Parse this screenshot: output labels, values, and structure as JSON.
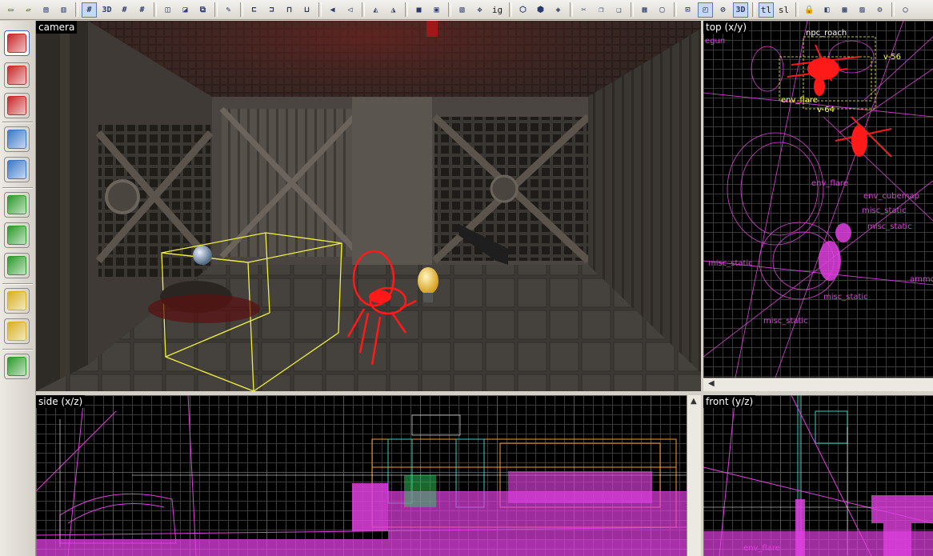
{
  "toolbar": {
    "items": [
      {
        "name": "new-file-icon",
        "glyph": "▭"
      },
      {
        "name": "open-file-icon",
        "glyph": "▱"
      },
      {
        "name": "save-icon",
        "glyph": "▤"
      },
      {
        "name": "save-as-icon",
        "glyph": "▥"
      },
      {
        "sep": true
      },
      {
        "name": "grid-icon",
        "glyph": "#",
        "pressed": true
      },
      {
        "name": "3d-grid-icon",
        "glyph": "3D"
      },
      {
        "name": "grid-smaller-icon",
        "glyph": "#"
      },
      {
        "name": "grid-larger-icon",
        "glyph": "#"
      },
      {
        "sep": true
      },
      {
        "name": "group-icon",
        "glyph": "◫"
      },
      {
        "name": "ungroup-icon",
        "glyph": "◪"
      },
      {
        "name": "ignore-groups-icon",
        "glyph": "⧉"
      },
      {
        "sep": true
      },
      {
        "name": "texture-lock-icon",
        "glyph": "✎"
      },
      {
        "sep": true
      },
      {
        "name": "align-left-icon",
        "glyph": "⊏"
      },
      {
        "name": "align-right-icon",
        "glyph": "⊐"
      },
      {
        "name": "align-top-icon",
        "glyph": "⊓"
      },
      {
        "name": "align-bottom-icon",
        "glyph": "⊔"
      },
      {
        "sep": true
      },
      {
        "name": "flip-horizontal-icon",
        "glyph": "◀"
      },
      {
        "name": "flip-vertical-icon",
        "glyph": "◁"
      },
      {
        "sep": true
      },
      {
        "name": "rotate-icon",
        "glyph": "◭"
      },
      {
        "name": "rotate-ccw-icon",
        "glyph": "◮"
      },
      {
        "sep": true
      },
      {
        "name": "carve-icon",
        "glyph": "■"
      },
      {
        "name": "hollow-icon",
        "glyph": "▣"
      },
      {
        "sep": true
      },
      {
        "name": "clip-icon",
        "glyph": "▧"
      },
      {
        "name": "vertex-icon",
        "glyph": "✥"
      },
      {
        "name": "ig-toggle",
        "text": "ig"
      },
      {
        "sep": true
      },
      {
        "name": "cordon-icon",
        "glyph": "⬡"
      },
      {
        "name": "cordon-edit-icon",
        "glyph": "⬢"
      },
      {
        "name": "hide-icon",
        "glyph": "◈"
      },
      {
        "sep": true
      },
      {
        "name": "cut-icon",
        "glyph": "✂"
      },
      {
        "name": "copy-icon",
        "glyph": "❐"
      },
      {
        "name": "paste-icon",
        "glyph": "❑"
      },
      {
        "sep": true
      },
      {
        "name": "select-all-icon",
        "glyph": "▦"
      },
      {
        "name": "select-box-icon",
        "glyph": "▢"
      },
      {
        "sep": true
      },
      {
        "name": "zoom-fit-icon",
        "glyph": "⊡"
      },
      {
        "name": "select-mode-icon",
        "glyph": "◰",
        "pressed": true
      },
      {
        "name": "no-draw-icon",
        "glyph": "⊘"
      },
      {
        "name": "3d-view-icon",
        "glyph": "3D",
        "pressed": true
      },
      {
        "sep": true
      },
      {
        "name": "texture-lock-toggle",
        "text": "tl",
        "pressed": true
      },
      {
        "name": "sl-toggle",
        "text": "sl"
      },
      {
        "sep": true
      },
      {
        "name": "lock-icon",
        "glyph": "🔒"
      },
      {
        "name": "color-icon",
        "glyph": "◧"
      },
      {
        "name": "entity-report-icon",
        "glyph": "▩"
      },
      {
        "name": "check-problems-icon",
        "glyph": "▨"
      },
      {
        "name": "tools-icon",
        "glyph": "⚙"
      },
      {
        "sep": true
      },
      {
        "name": "help-icon",
        "glyph": "◯"
      }
    ]
  },
  "left_tools": [
    {
      "name": "selection-tool-icon",
      "color": "#c8282a",
      "active": true
    },
    {
      "name": "magnify-tool-icon",
      "color": "#c8282a"
    },
    {
      "name": "camera-tool-icon",
      "color": "#c8282a"
    },
    {
      "name": "entity-tool-icon",
      "color": "#3a78c8"
    },
    {
      "name": "block-tool-icon",
      "color": "#3a78c8"
    },
    {
      "name": "texture-tool-icon",
      "color": "#2a9a2a"
    },
    {
      "name": "apply-texture-icon",
      "color": "#2a9a2a"
    },
    {
      "name": "decal-tool-icon",
      "color": "#2a9a2a"
    },
    {
      "name": "overlay-tool-icon",
      "color": "#d8b020"
    },
    {
      "name": "clipping-tool-icon",
      "color": "#d8b020"
    },
    {
      "name": "vertex-tool-icon",
      "color": "#2a9a2a"
    }
  ],
  "viewports": {
    "camera": {
      "label": "camera"
    },
    "top": {
      "label": "top (x/y)"
    },
    "side": {
      "label": "side (x/z)"
    },
    "front": {
      "label": "front (y/z)"
    }
  },
  "top_entities": [
    {
      "text": "npc_roach",
      "color": "#ffffff"
    },
    {
      "text": "egun",
      "color": "#e040e0"
    },
    {
      "text": "v-56",
      "color": "#ffff40"
    },
    {
      "text": "env_flare",
      "color": "#ffff40"
    },
    {
      "text": "v-64",
      "color": "#ffff40"
    },
    {
      "text": "env_flare",
      "color": "#e040e0"
    },
    {
      "text": "env_cubemap",
      "color": "#e040e0"
    },
    {
      "text": "misc_static",
      "color": "#e040e0"
    },
    {
      "text": "misc_static",
      "color": "#e040e0"
    },
    {
      "text": "misc_static",
      "color": "#e040e0"
    },
    {
      "text": "ammo",
      "color": "#e040e0"
    },
    {
      "text": "misc_static",
      "color": "#e040e0"
    },
    {
      "text": "misc_static",
      "color": "#e040e0"
    }
  ],
  "front_entities": [
    {
      "text": "env_flare",
      "color": "#e040e0"
    }
  ],
  "colors": {
    "wire_entity": "#e040e0",
    "selected": "#ff2020",
    "yellow": "#ffff40"
  }
}
